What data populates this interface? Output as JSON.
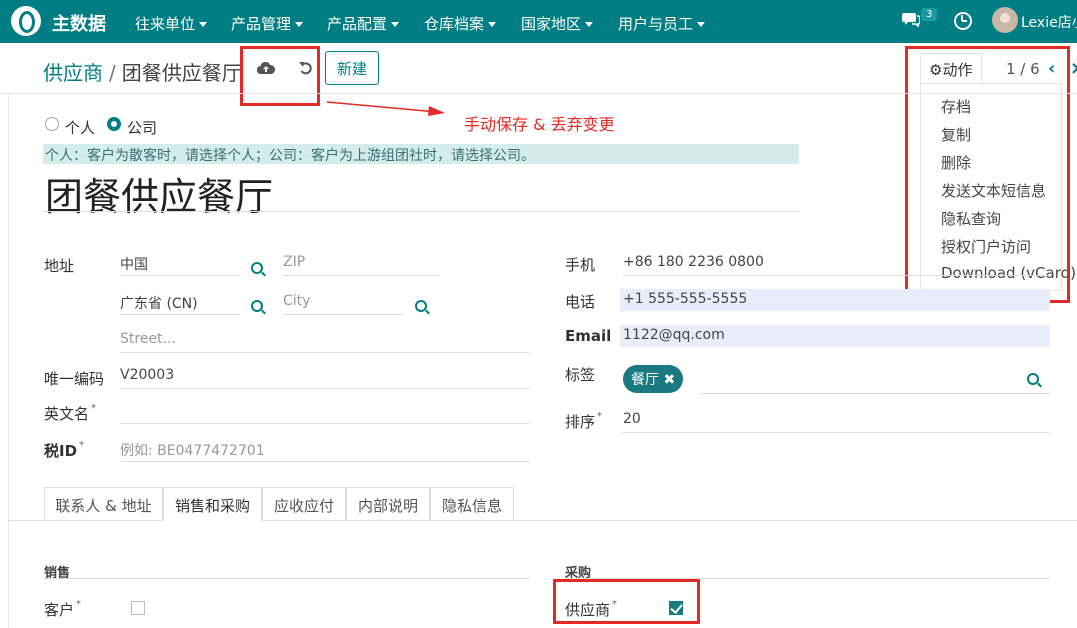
{
  "navbar": {
    "app_title": "主数据",
    "menus": [
      "往来单位",
      "产品管理",
      "产品配置",
      "仓库档案",
      "国家地区",
      "用户与员工"
    ],
    "message_count": "3",
    "user_name": "Lexie店小"
  },
  "breadcrumb": {
    "parent": "供应商",
    "separator": "/",
    "current": "团餐供应餐厅"
  },
  "toolbar": {
    "save_icon": "cloud-upload-icon",
    "discard_icon": "undo-icon",
    "new_label": "新建",
    "action_label": "动作",
    "action_icon": "gear-icon",
    "pager": "1 / 6"
  },
  "action_menu": {
    "items": [
      "存档",
      "复制",
      "删除",
      "发送文本短信息",
      "隐私查询",
      "授权门户访问",
      "Download (vCard)"
    ]
  },
  "annotation": {
    "text": "手动保存 & 丢弃变更",
    "color": "#e42a26"
  },
  "form": {
    "company_type": {
      "options": [
        "个人",
        "公司"
      ],
      "selected": "公司"
    },
    "hint": "个人：客户为散客时，请选择个人；公司：客户为上游组团社时，请选择公司。",
    "name": "团餐供应餐厅",
    "address": {
      "label": "地址",
      "country": "中国",
      "zip_placeholder": "ZIP",
      "state": "广东省 (CN)",
      "city_placeholder": "City",
      "street_placeholder": "Street..."
    },
    "code": {
      "label": "唯一编码",
      "value": "V20003"
    },
    "english_name": {
      "label": "英文名",
      "value": ""
    },
    "tax_id": {
      "label": "税ID",
      "placeholder": "例如: BE0477472701"
    },
    "mobile": {
      "label": "手机",
      "value": "+86 180 2236 0800"
    },
    "phone": {
      "label": "电话",
      "value": "+1 555-555-5555"
    },
    "email": {
      "label": "Email",
      "value": "1122@qq.com"
    },
    "tags": {
      "label": "标签",
      "items": [
        "餐厅"
      ]
    },
    "sequence": {
      "label": "排序",
      "value": "20"
    },
    "required_mark": "*"
  },
  "tabs": [
    "联系人 & 地址",
    "销售和采购",
    "应收应付",
    "内部说明",
    "隐私信息"
  ],
  "active_tab": "销售和采购",
  "sales": {
    "title": "销售",
    "customer_label": "客户",
    "customer_checked": false
  },
  "purchase": {
    "title": "采购",
    "supplier_label": "供应商",
    "supplier_checked": true
  },
  "colors": {
    "brand": "#017e84",
    "annotation": "#e42a26",
    "tag": "#1b7a80"
  }
}
